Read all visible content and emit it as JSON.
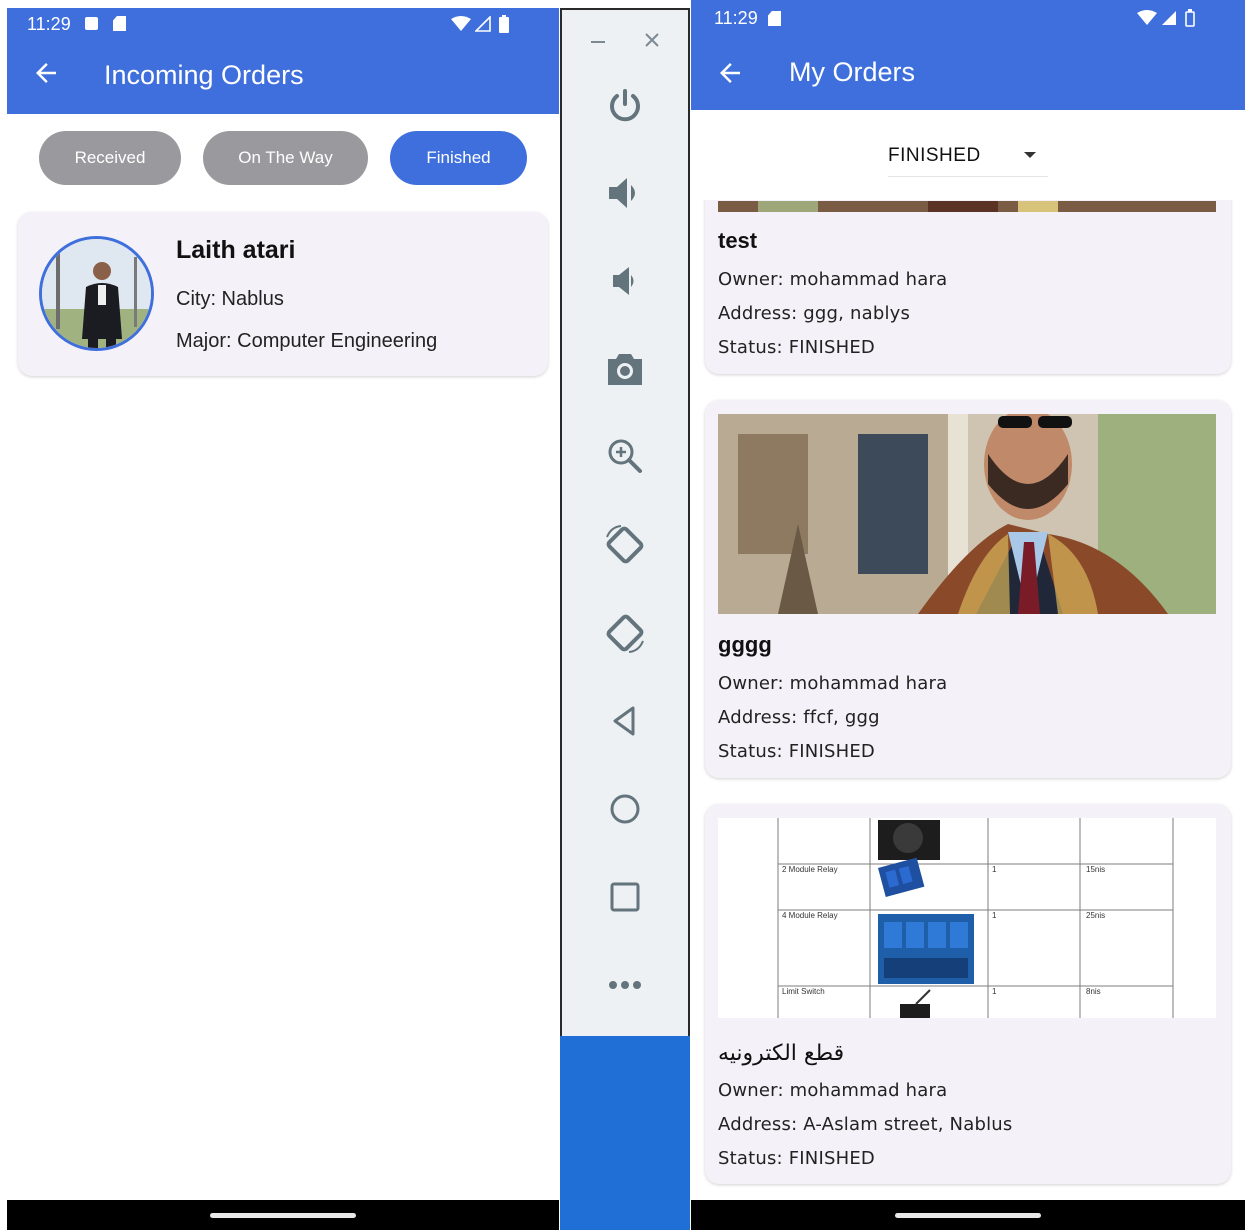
{
  "left_phone": {
    "status_time": "11:29",
    "title": "Incoming Orders",
    "tabs": [
      {
        "label": "Received",
        "state": "inactive"
      },
      {
        "label": "On The Way",
        "state": "inactive"
      },
      {
        "label": "Finished",
        "state": "active"
      }
    ],
    "person": {
      "name": "Laith atari",
      "city": "City: Nablus",
      "major": "Major: Computer Engineering"
    }
  },
  "toolbar": {
    "icons": [
      "minimize-icon",
      "close-icon",
      "power-icon",
      "volume-up-icon",
      "volume-down-icon",
      "camera-icon",
      "zoom-in-icon",
      "rotate-left-icon",
      "rotate-right-icon",
      "back-icon",
      "home-icon",
      "overview-icon",
      "more-icon"
    ]
  },
  "right_phone": {
    "status_time": "11:29",
    "title": "My Orders",
    "filter_value": "FINISHED",
    "orders": [
      {
        "title": "test",
        "owner": "Owner: mohammad hara",
        "address": "Address: ggg, nablys",
        "status": "Status: FINISHED"
      },
      {
        "title": "gggg",
        "owner": "Owner: mohammad hara",
        "address": "Address: ffcf, ggg",
        "status": "Status: FINISHED"
      },
      {
        "title": "قطع الكترونيه",
        "owner": "Owner: mohammad hara",
        "address": "Address: A-Aslam street, Nablus",
        "status": "Status: FINISHED",
        "table_rows": [
          {
            "name": "2 Module Relay",
            "qty": "1",
            "price": "15nis"
          },
          {
            "name": "4 Module Relay",
            "qty": "1",
            "price": "25nis"
          },
          {
            "name": "Limit Switch",
            "qty": "1",
            "price": "8nis"
          }
        ]
      }
    ]
  },
  "colors": {
    "primary": "#3f6fdc",
    "chip_inactive": "#9a9a9e",
    "card_bg": "#f4f1f8",
    "toolbar_bg": "#eef1f4",
    "toolbar_accent": "#1f6fd6"
  }
}
